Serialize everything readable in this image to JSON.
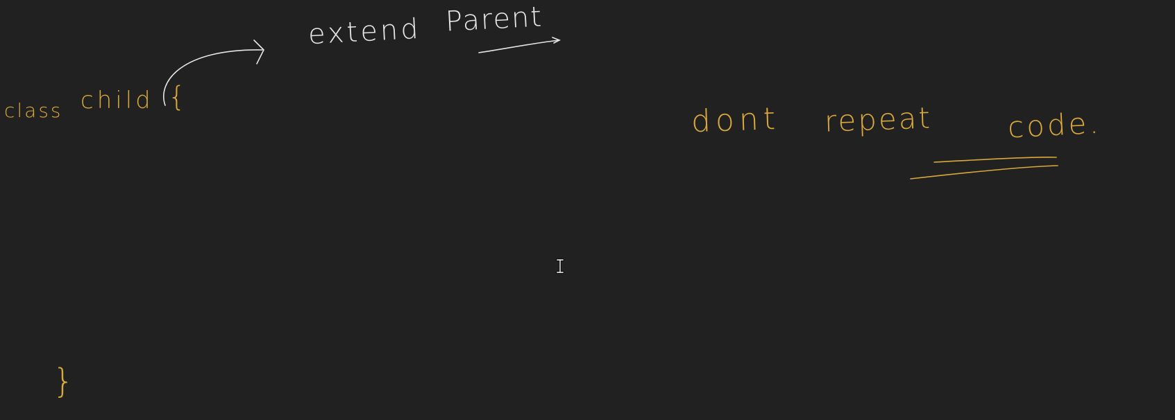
{
  "whiteboard": {
    "annotations": {
      "extend": "extend",
      "parent": "Parent",
      "class": "class",
      "child": "child",
      "open_brace": "{",
      "dont": "dont",
      "repeat": "repeat",
      "code": "code.",
      "close_brace": "}"
    },
    "colors": {
      "background": "#212121",
      "white_ink": "#e6e6e6",
      "gold_ink": "#d9a93c"
    },
    "cursor": "text-cursor-icon"
  }
}
